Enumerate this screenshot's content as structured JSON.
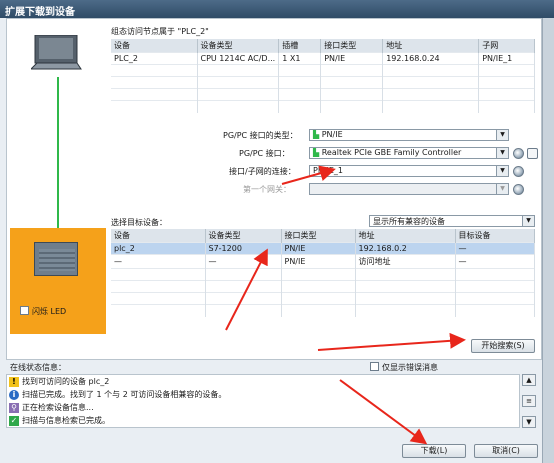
{
  "window": {
    "title": "扩展下载到设备"
  },
  "accessible": {
    "caption": "组态访问节点属于 \"PLC_2\"",
    "columns": [
      "设备",
      "设备类型",
      "插槽",
      "接口类型",
      "地址",
      "子网"
    ],
    "rows": [
      [
        "PLC_2",
        "CPU 1214C AC/D...",
        "1 X1",
        "PN/IE",
        "192.168.0.24",
        "PN/IE_1"
      ]
    ]
  },
  "interface": {
    "type_label": "PG/PC 接口的类型：",
    "type_value": "PN/IE",
    "iface_label": "PG/PC 接口：",
    "iface_value": "Realtek PCIe GBE Family Controller",
    "subnet_label": "接口/子网的连接：",
    "subnet_value": "PN/IE_1",
    "gateway_label": "第一个网关："
  },
  "target": {
    "caption": "选择目标设备：",
    "filter_value": "显示所有兼容的设备",
    "columns": [
      "设备",
      "设备类型",
      "接口类型",
      "地址",
      "目标设备"
    ],
    "rows": [
      [
        "plc_2",
        "S7-1200",
        "PN/IE",
        "192.168.0.2",
        "—"
      ],
      [
        "—",
        "—",
        "PN/IE",
        "访问地址",
        "—"
      ]
    ]
  },
  "flash_led_label": "闪烁 LED",
  "start_search_label": "开始搜索(S)",
  "status": {
    "caption": "在线状态信息：",
    "show_errors_label": "仅显示错误消息",
    "messages": [
      {
        "icon": "warning-icon",
        "text": "找到可访问的设备 plc_2"
      },
      {
        "icon": "info-icon",
        "text": "扫描已完成。找到了 1 个与 2 可访问设备相兼容的设备。"
      },
      {
        "icon": "search-progress-icon",
        "text": "正在检索设备信息..."
      },
      {
        "icon": "check-icon",
        "text": "扫描与信息检索已完成。"
      }
    ]
  },
  "buttons": {
    "download": "下载(L)",
    "cancel": "取消(C)"
  },
  "colors": {
    "highlight_orange": "#f5a11a",
    "arrow_red": "#e8261b",
    "link_green": "#2fb84a"
  }
}
